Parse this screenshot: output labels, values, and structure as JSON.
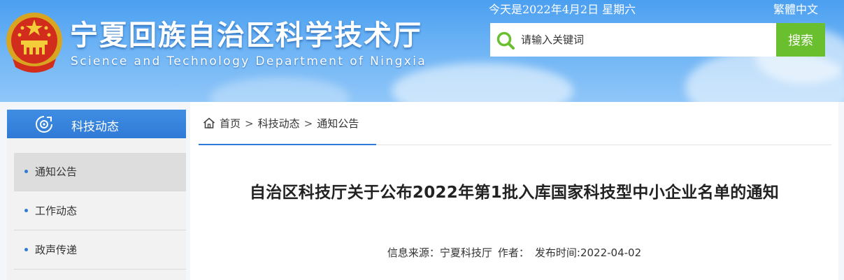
{
  "header": {
    "site_title": "宁夏回族自治区科学技术厅",
    "site_subtitle": "Science and Technology Department of Ningxia",
    "date_text": "今天是2022年4月2日 星期六",
    "lang_link": "繁體中文",
    "emblem_icon": "national-emblem-icon"
  },
  "search": {
    "placeholder": "请输入关键词",
    "value": "",
    "button_label": "搜索",
    "icon": "search-icon",
    "button_color": "#6abf2f"
  },
  "sidebar": {
    "heading": "科技动态",
    "heading_icon": "compass-icon",
    "items": [
      {
        "label": "通知公告",
        "active": true
      },
      {
        "label": "工作动态",
        "active": false
      },
      {
        "label": "政声传递",
        "active": false
      }
    ]
  },
  "breadcrumb": {
    "home_icon": "home-icon",
    "items": [
      "首页",
      "科技动态",
      "通知公告"
    ],
    "separator": ">"
  },
  "article": {
    "title": "自治区科技厅关于公布2022年第1批入库国家科技型中小企业名单的通知",
    "source": "信息来源：宁夏科技厅",
    "author": "作者：",
    "publish_time": "发布时间:2022-04-02"
  },
  "colors": {
    "accent": "#2f7ad6",
    "header_blue": "#4b9ff0",
    "search_green": "#6abf2f"
  }
}
